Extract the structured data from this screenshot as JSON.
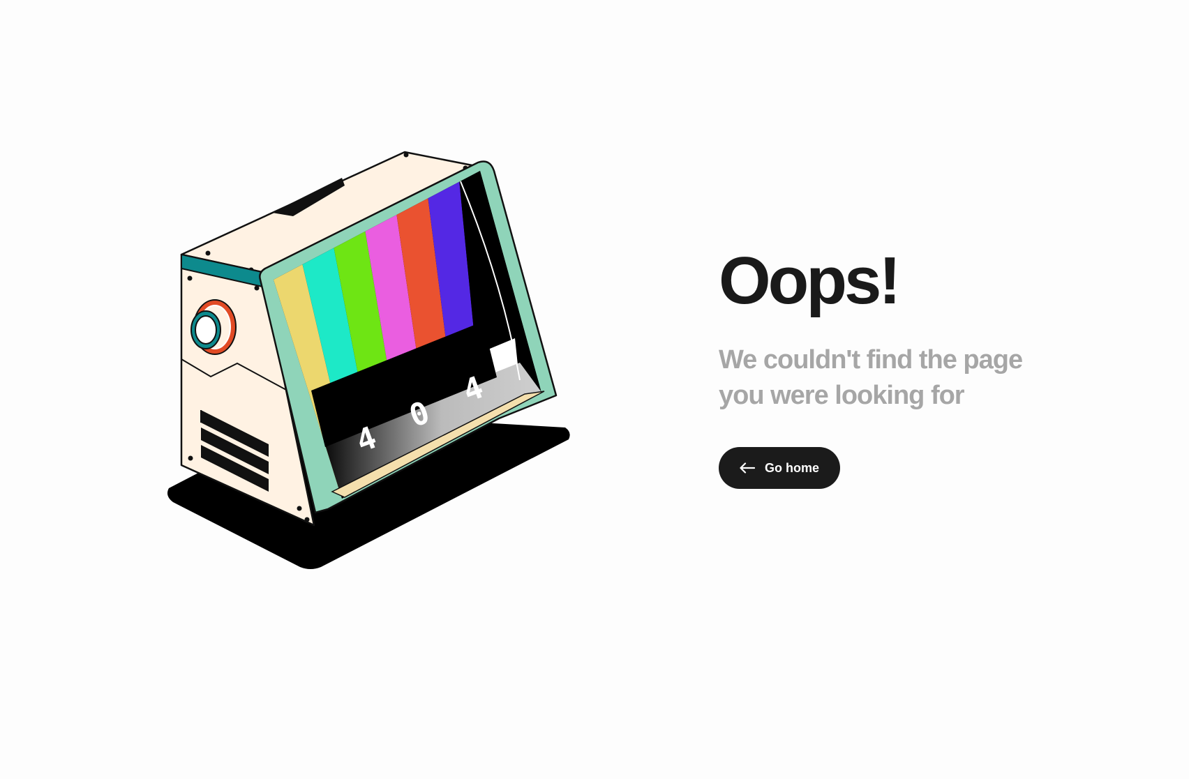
{
  "main": {
    "title": "Oops!",
    "subtitle": "We couldn't find the page you were looking for",
    "home_button": {
      "label": "Go home",
      "icon": "arrow-left-icon"
    }
  },
  "illustration": {
    "icon": "retro-tv-icon",
    "screen_digits": [
      "4",
      "0",
      "4"
    ],
    "color_bars": [
      "#ecd76e",
      "#1de9c7",
      "#6ee514",
      "#ea5ee0",
      "#ea5230",
      "#5428e4",
      "#000000"
    ],
    "colors": {
      "cabinet": "#fff2e3",
      "bezel": "#8fd4b9",
      "accent_teal": "#0d8a8d",
      "knob_ring": "#e14b25"
    }
  },
  "colors": {
    "background": "#fdfdfd",
    "title": "#1a1a1a",
    "subtitle": "#a6a6a6",
    "button_bg": "#1b1b1b",
    "button_text": "#ffffff"
  }
}
